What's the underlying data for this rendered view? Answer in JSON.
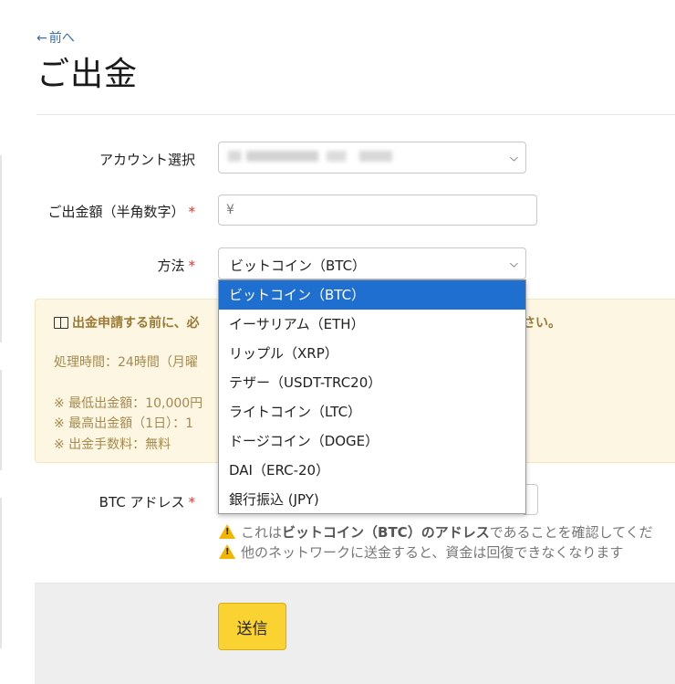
{
  "nav": {
    "back_arrow": "←",
    "back_label": "前へ"
  },
  "page": {
    "title": "ご出金"
  },
  "form": {
    "account": {
      "label": "アカウント選択"
    },
    "amount": {
      "label": "ご出金額（半角数字）",
      "required_mark": "*",
      "prefix": "¥"
    },
    "method": {
      "label": "方法",
      "required_mark": "*",
      "selected": "ビットコイン（BTC）"
    },
    "address": {
      "label": "BTC アドレス",
      "required_mark": "*"
    }
  },
  "notice": {
    "heading_left": "出金申請する前に、必",
    "heading_right": "さい。",
    "processing": "処理時間：24時間（月曜",
    "min": "※ 最低出金額：10,000円",
    "max": "※ 最高出金額（1日）：1",
    "fee": "※ 出金手数料：無料"
  },
  "warnings": {
    "w1_pre": "これは",
    "w1_bold": "ビットコイン（BTC）のアドレス",
    "w1_post": "であることを確認してくだ",
    "w2": "他のネットワークに送金すると、資金は回復できなくなります"
  },
  "dropdown": {
    "options": [
      "ビットコイン（BTC）",
      "イーサリアム（ETH）",
      "リップル（XRP）",
      "テザー（USDT-TRC20）",
      "ライトコイン（LTC）",
      "ドージコイン（DOGE）",
      "DAI（ERC-20）",
      "銀行振込 (JPY)"
    ]
  },
  "submit": {
    "label": "送信"
  },
  "colors": {
    "accent": "#1f6fd0",
    "button": "#fad232",
    "notice_bg": "#fdf6e3",
    "required": "#e0362f"
  },
  "icons": {
    "back": "arrow-left-icon",
    "book": "book-icon",
    "warning": "warning-icon",
    "chevron": "chevron-down-icon"
  }
}
